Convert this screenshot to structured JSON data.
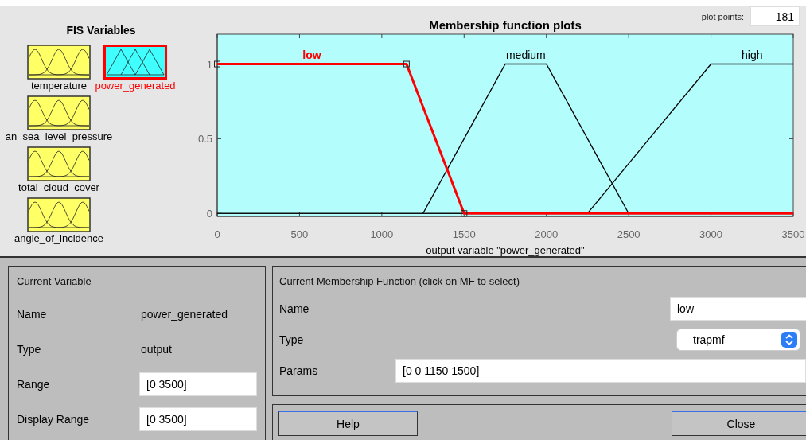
{
  "fis_variables": {
    "title": "FIS Variables",
    "inputs": [
      {
        "label": "temperature",
        "kind": "input",
        "selected": false
      },
      {
        "label": "an_sea_level_pressure",
        "kind": "input",
        "selected": false
      },
      {
        "label": "total_cloud_cover",
        "kind": "input",
        "selected": false
      },
      {
        "label": "angle_of_incidence",
        "kind": "input",
        "selected": false
      }
    ],
    "outputs": [
      {
        "label": "power_generated",
        "kind": "output",
        "selected": true
      }
    ]
  },
  "plot_points": {
    "label": "plot points:",
    "value": "181"
  },
  "plot": {
    "chart_data": {
      "type": "line",
      "title": "Membership function plots",
      "xlabel": "output variable \"power_generated\"",
      "x": [
        0,
        1150,
        1250,
        1500,
        1750,
        2000,
        2250,
        2500,
        3000,
        3500
      ],
      "series": [
        {
          "name": "low",
          "color": "#ff0000",
          "values": [
            1,
            1,
            0.714,
            0,
            0,
            0,
            0,
            0,
            0,
            0
          ]
        },
        {
          "name": "medium",
          "color": "#000000",
          "values": [
            null,
            null,
            0,
            0.5,
            1,
            1,
            0.5,
            0,
            null,
            null
          ]
        },
        {
          "name": "high",
          "color": "#000000",
          "values": [
            null,
            null,
            null,
            null,
            null,
            null,
            0,
            0.333,
            1,
            1
          ]
        }
      ],
      "xlim": [
        0,
        3500
      ],
      "ylim": [
        -0.02,
        1.2
      ],
      "xticks": [
        0,
        500,
        1000,
        1500,
        2000,
        2500,
        3000,
        3500
      ],
      "yticks": [
        0,
        {
          "value": 0.5,
          "label": "0.5"
        },
        1
      ]
    }
  },
  "current_variable": {
    "title": "Current Variable",
    "rows": [
      {
        "label": "Name",
        "value": "power_generated",
        "kind": "text"
      },
      {
        "label": "Type",
        "value": "output",
        "kind": "text"
      },
      {
        "label": "Range",
        "value": "[0 3500]",
        "kind": "field"
      },
      {
        "label": "Display Range",
        "value": "[0 3500]",
        "kind": "field"
      }
    ]
  },
  "current_mf": {
    "title": "Current Membership Function (click on MF to select)",
    "name": {
      "label": "Name",
      "value": "low"
    },
    "type": {
      "label": "Type",
      "value": "trapmf"
    },
    "params": {
      "label": "Params",
      "value": "[0 0 1150 1500]"
    }
  },
  "buttons": [
    "Help",
    "Close"
  ]
}
